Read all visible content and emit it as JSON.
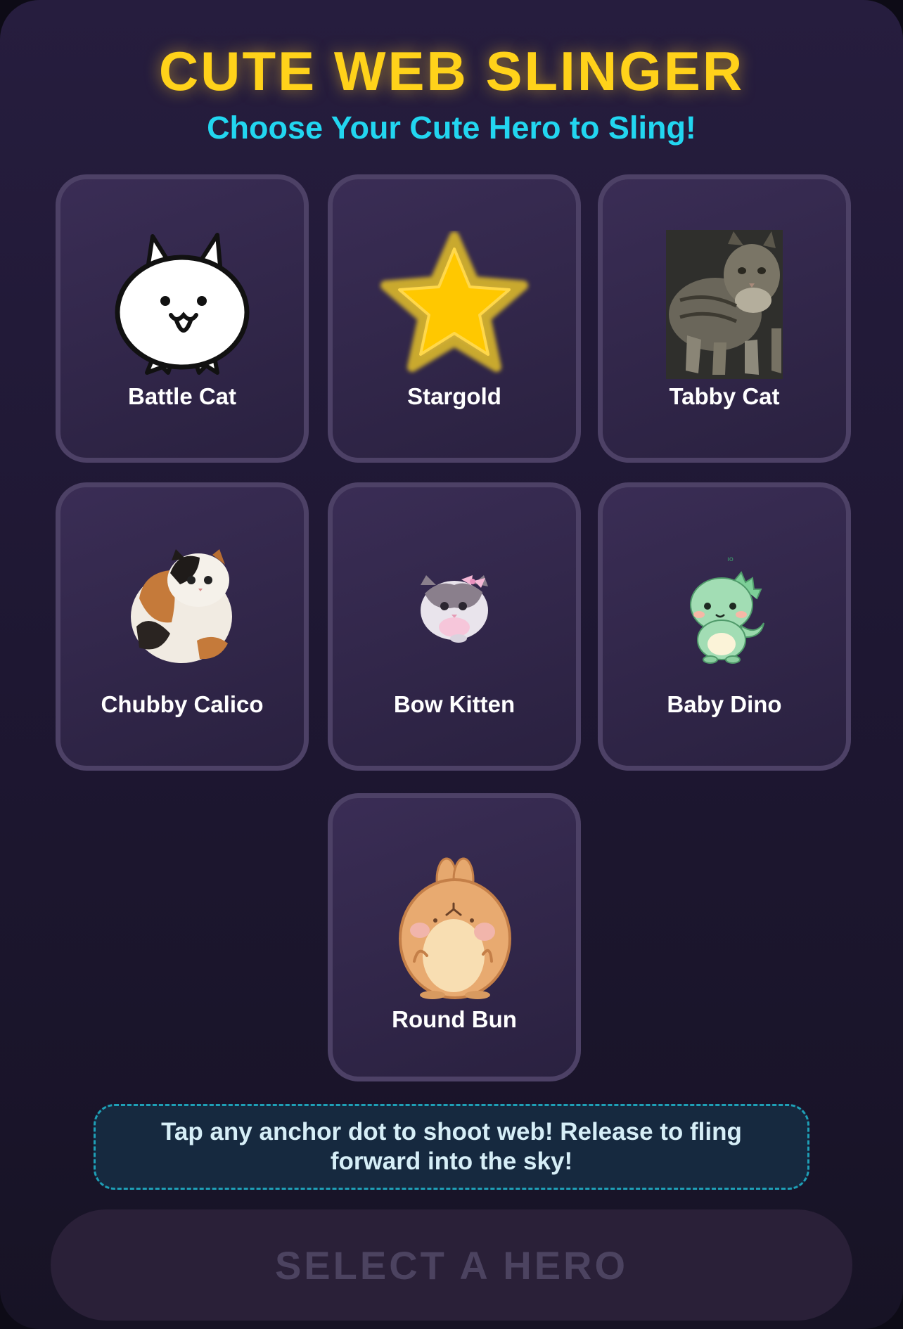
{
  "header": {
    "title": "CUTE WEB SLINGER",
    "subtitle": "Choose Your Cute Hero to Sling!"
  },
  "heroes": [
    {
      "name": "Battle Cat",
      "icon": "battle-cat-icon"
    },
    {
      "name": "Stargold",
      "icon": "star-icon"
    },
    {
      "name": "Tabby Cat",
      "icon": "tabby-cat-photo"
    },
    {
      "name": "Chubby Calico",
      "icon": "calico-cat-photo"
    },
    {
      "name": "Bow Kitten",
      "icon": "kitten-with-bow-photo"
    },
    {
      "name": "Baby Dino",
      "icon": "baby-dino-icon"
    },
    {
      "name": "Round Bun",
      "icon": "round-bunny-icon"
    }
  ],
  "hint": {
    "text": "Tap any anchor dot to shoot web! Release to fling forward into the sky!"
  },
  "action": {
    "label": "SELECT A HERO"
  },
  "colors": {
    "title": "#ffd21a",
    "subtitle": "#22d6f0",
    "card_border": "#4d4166",
    "hint_border": "#1e9fb6",
    "button_text": "#4c4360"
  }
}
